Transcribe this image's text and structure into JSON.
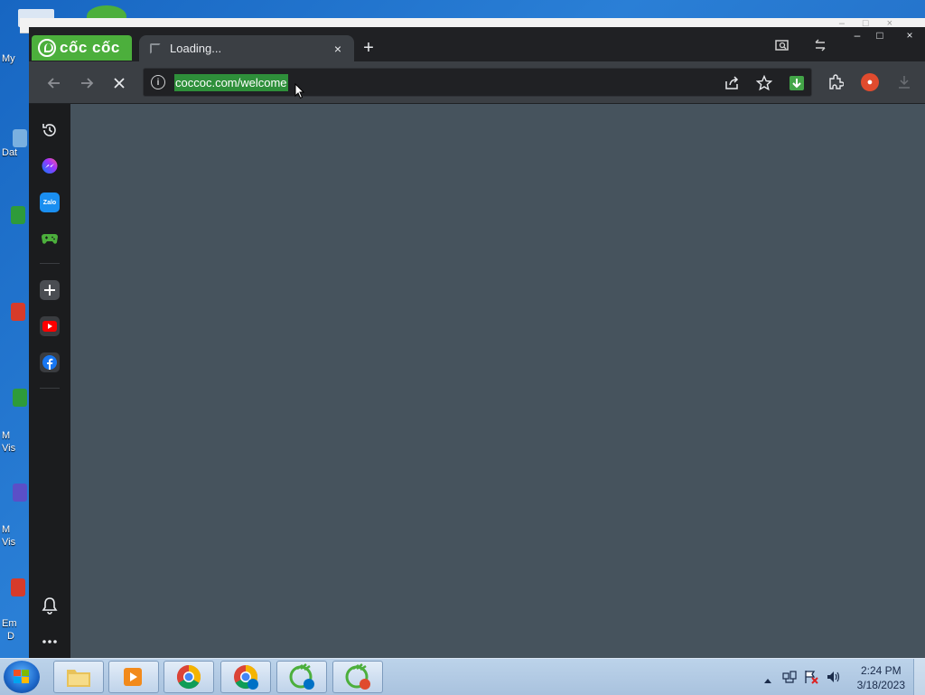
{
  "desktop": {
    "labels": [
      "My",
      "Dat",
      "M",
      "Vis",
      "M",
      "Vis",
      "Em",
      "D"
    ],
    "background_color": "#1766c2"
  },
  "browser": {
    "brand_name": "cốc cốc",
    "brand_color": "#4caf3c",
    "tab": {
      "title": "Loading...",
      "close_icon": "×"
    },
    "new_tab_icon": "+",
    "url": "coccoc.com/welcome",
    "window_buttons": {
      "minimize": "–",
      "maximize": "□",
      "close": "×"
    }
  },
  "sidebar": {
    "items": [
      {
        "name": "history-icon",
        "color": "#e8eaed"
      },
      {
        "name": "messenger-icon",
        "color": "#8a5cf6"
      },
      {
        "name": "zalo-icon",
        "color": "#1a8ef0"
      },
      {
        "name": "game-controller-icon",
        "color": "#4caf3c"
      },
      {
        "name": "add-icon",
        "color": "#e8eaed"
      },
      {
        "name": "youtube-icon",
        "color": "#ff0000"
      },
      {
        "name": "facebook-icon",
        "color": "#1877f2"
      },
      {
        "name": "bell-icon",
        "color": "#e8eaed"
      },
      {
        "name": "more-icon",
        "color": "#e8eaed"
      }
    ],
    "zalo_text": "Zalo"
  },
  "taskbar": {
    "apps": [
      "file-explorer",
      "media-player",
      "chrome",
      "chrome-intel",
      "coccoc-intel",
      "coccoc"
    ],
    "clock": {
      "time": "2:24 PM",
      "date": "3/18/2023"
    }
  }
}
